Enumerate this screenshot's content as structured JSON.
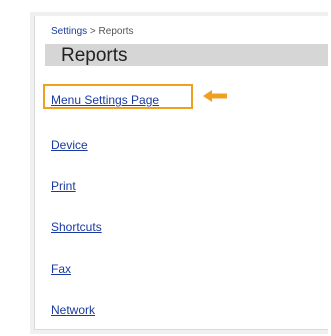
{
  "breadcrumb": {
    "parent": "Settings",
    "separator": ">",
    "current": "Reports"
  },
  "page": {
    "title": "Reports"
  },
  "menu": {
    "items": [
      {
        "label": "Menu Settings Page",
        "highlighted": true
      },
      {
        "label": "Device"
      },
      {
        "label": "Print"
      },
      {
        "label": "Shortcuts"
      },
      {
        "label": "Fax"
      },
      {
        "label": "Network"
      }
    ]
  },
  "colors": {
    "highlight": "#f0a020",
    "link": "#1a3aa0",
    "title_bar": "#d6d6d6"
  },
  "icons": {
    "pointer": "left-arrow-icon"
  }
}
